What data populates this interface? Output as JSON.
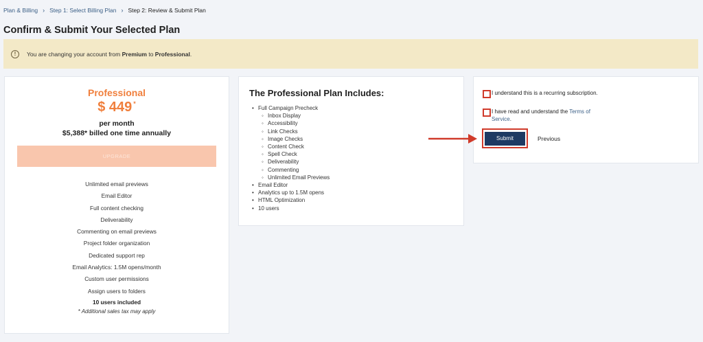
{
  "breadcrumb": {
    "items": [
      "Plan & Billing",
      "Step 1: Select Billing Plan"
    ],
    "current": "Step 2: Review & Submit Plan",
    "separator": "›"
  },
  "page_title": "Confirm & Submit Your Selected Plan",
  "notice": {
    "icon": "exclamation-circle-icon",
    "prefix": "You are changing your account from ",
    "from_plan": "Premium",
    "middle": " to ",
    "to_plan": "Professional",
    "suffix": "."
  },
  "plan_card": {
    "name": "Professional",
    "price": "$ 449",
    "price_asterisk": "*",
    "per_month": "per month",
    "annual": "$5,388* billed one time annually",
    "upgrade_label": "UPGRADE",
    "features": [
      "Unlimited email previews",
      "Email Editor",
      "Full content checking",
      "Deliverability",
      "Commenting on email previews",
      "Project folder organization",
      "Dedicated support rep",
      "Email Analytics: 1.5M opens/month",
      "Custom user permissions",
      "Assign users to folders"
    ],
    "users_included": "10 users included",
    "tax_note": "* Additional sales tax may apply"
  },
  "includes_card": {
    "title": "The Professional Plan Includes:",
    "items": [
      {
        "label": "Full Campaign Precheck",
        "sub": [
          "Inbox Display",
          "Accessibility",
          "Link Checks",
          "Image Checks",
          "Content Check",
          "Spell Check",
          "Deliverability",
          "Commenting",
          "Unlimited Email Previews"
        ]
      },
      {
        "label": "Email Editor"
      },
      {
        "label": "Analytics up to 1.5M opens"
      },
      {
        "label": "HTML Optimization"
      },
      {
        "label": "10 users"
      }
    ]
  },
  "confirm_card": {
    "recurring_label": "I understand this is a recurring subscription.",
    "terms_prefix": "I have read and understand the ",
    "terms_link": "Terms of Service",
    "terms_suffix": ".",
    "submit_label": "Submit",
    "previous_label": "Previous"
  },
  "colors": {
    "accent_orange": "#f07f3c",
    "submit_navy": "#1e3a63",
    "highlight_red": "#d03a2a",
    "notice_bg": "#f3e9c7",
    "link_blue": "#3b5f86"
  }
}
